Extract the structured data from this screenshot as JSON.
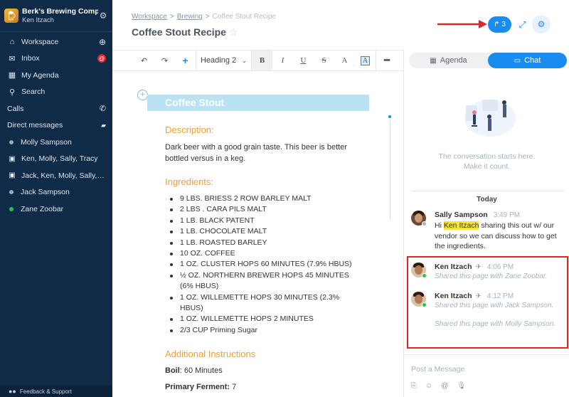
{
  "sidebar": {
    "team_name": "Berk's Brewing Comp",
    "user_name": "Ken Itzach",
    "items": [
      {
        "label": "Workspace",
        "icon": "home-icon"
      },
      {
        "label": "Inbox",
        "icon": "inbox-icon",
        "badge": "@"
      },
      {
        "label": "My Agenda",
        "icon": "calendar-icon"
      },
      {
        "label": "Search",
        "icon": "search-icon"
      }
    ],
    "calls_label": "Calls",
    "dm_label": "Direct messages",
    "dms": [
      {
        "label": "Molly Sampson",
        "status": "offline"
      },
      {
        "label": "Ken, Molly, Sally, Tracy",
        "status": "group"
      },
      {
        "label": "Jack, Ken, Molly, Sally, Sc...",
        "status": "group"
      },
      {
        "label": "Jack Sampson",
        "status": "offline"
      },
      {
        "label": "Zane Zoobar",
        "status": "online"
      }
    ],
    "footer": "Feedback & Support"
  },
  "header": {
    "crumbs": [
      "Workspace",
      "Brewing",
      "Coffee Stout Recipe"
    ],
    "title": "Coffee Stout Recipe",
    "share_count": "3"
  },
  "toolbar": {
    "heading_select": "Heading 2",
    "bold": "B",
    "italic": "I",
    "underline": "U",
    "strike": "S",
    "text_color": "A",
    "highlight": "A",
    "more": "•••"
  },
  "doc": {
    "heading": "Coffee Stout",
    "description_h": "Description:",
    "description": "Dark beer with a good grain taste. This beer is better bottled versus in a keg.",
    "ingredients_h": "Ingredients:",
    "ingredients": [
      "9 LBS. BRIESS 2 ROW BARLEY MALT",
      "2 LBS . CARA PILS MALT",
      "1 LB. BLACK PATENT",
      "1 LB. CHOCOLATE MALT",
      "1 LB. ROASTED BARLEY",
      "10 OZ. COFFEE",
      "1 OZ. CLUSTER HOPS 60 MINUTES (7.9% HBUS)",
      "½ OZ. NORTHERN BREWER HOPS 45 MINUTES (6% HBUS)",
      "1 OZ. WILLEMETTE HOPS 30 MINUTES (2.3% HBUS)",
      "1 OZ. WILLEMETTE HOPS 2 MINUTES",
      "2/3 CUP Priming Sugar"
    ],
    "additional_h": "Additional Instructions",
    "boil_key": "Boil",
    "boil_val": ": 60 Minutes",
    "ferment_key": "Primary Ferment:",
    "ferment_val": " 7"
  },
  "panel": {
    "tab_agenda": "Agenda",
    "tab_chat": "Chat",
    "conv_line1": "The conversation starts here.",
    "conv_line2": "Make it count.",
    "today": "Today",
    "messages": [
      {
        "who": "Sally Sampson",
        "time": "3:49 PM",
        "pre": "Hi ",
        "mention": "Ken Itzach",
        "post": " sharing this out w/ our vendor so we can discuss how to get the ingredients."
      },
      {
        "who": "Ken Itzach",
        "time": "4:06 PM",
        "shared": "Shared this page with Zane Zoobar."
      },
      {
        "who": "Ken Itzach",
        "time": "4:12 PM",
        "shared": "Shared this page with Jack Sampson.",
        "shared2": "Shared this page with Molly Sampson."
      }
    ],
    "composer_placeholder": "Post a Message"
  },
  "colors": {
    "sidebar_bg": "#0f2b47",
    "accent": "#1a8cf0",
    "section_heading": "#f0a030",
    "doc_heading_bg": "#b9e3f4",
    "annotation_red": "#e0262a",
    "mention_highlight": "#f6e33a"
  }
}
